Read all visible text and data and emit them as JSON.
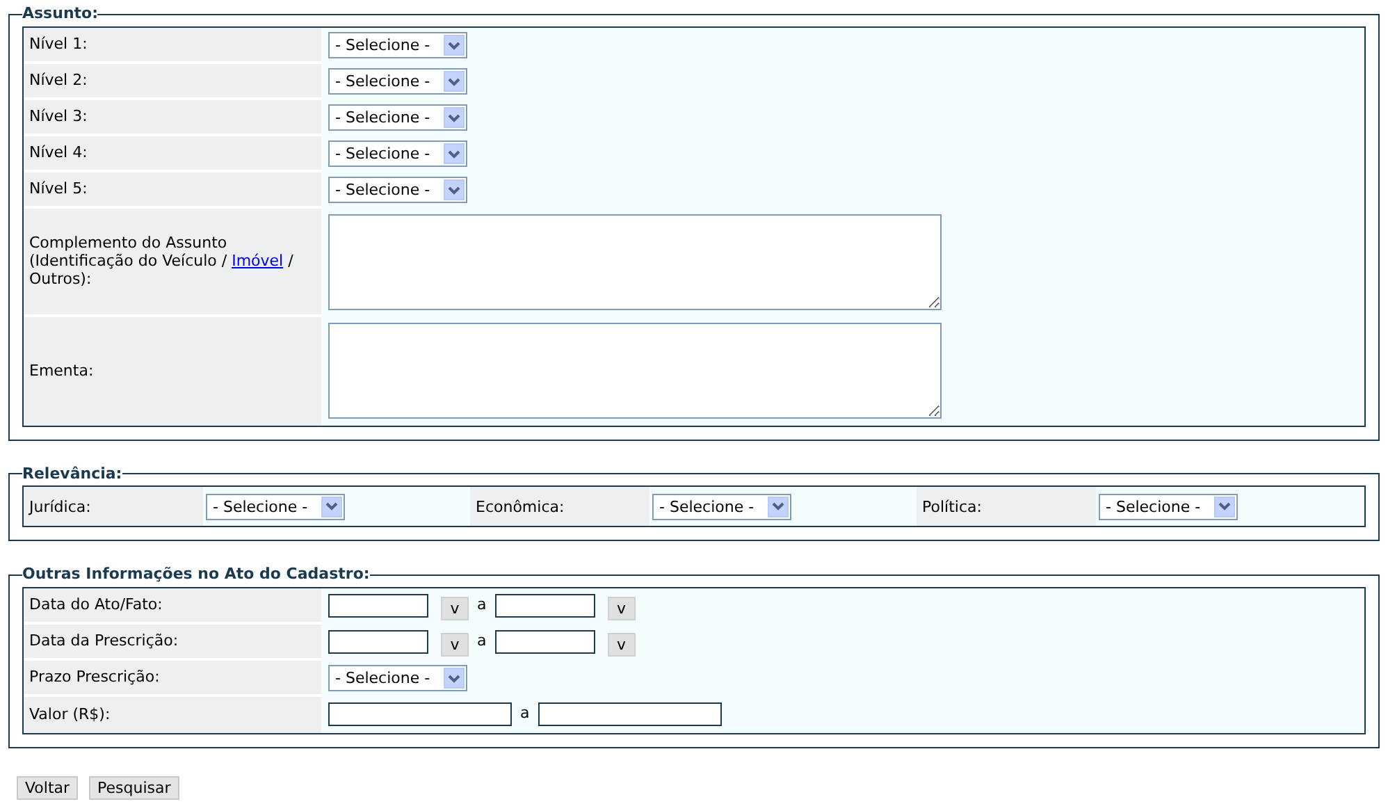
{
  "sections": [
    {
      "kind": "rows",
      "legend": "Assunto:",
      "rows": [
        {
          "kind": "select",
          "label": "Nível 1:",
          "value": "- Selecione -"
        },
        {
          "kind": "select",
          "label": "Nível 2:",
          "value": "- Selecione -"
        },
        {
          "kind": "select",
          "label": "Nível 3:",
          "value": "- Selecione -"
        },
        {
          "kind": "select",
          "label": "Nível 4:",
          "value": "- Selecione -"
        },
        {
          "kind": "select",
          "label": "Nível 5:",
          "value": "- Selecione -"
        },
        {
          "kind": "textarea",
          "label": "Complemento do Assunto (Identificação do Veículo /",
          "link": "Imóvel",
          "label_end": "/ Outros):"
        },
        {
          "kind": "textarea",
          "label": "Ementa:"
        }
      ]
    },
    {
      "kind": "columns",
      "legend": "Relevância:",
      "items": [
        {
          "label": "Jurídica:",
          "value": "- Selecione -"
        },
        {
          "label": "Econômica:",
          "value": "- Selecione -"
        },
        {
          "label": "Política:",
          "value": "- Selecione -"
        }
      ]
    },
    {
      "kind": "rows",
      "legend": "Outras Informações no Ato do Cadastro:",
      "rows": [
        {
          "kind": "date_range",
          "label": "Data do Ato/Fato:",
          "button": "v",
          "separator": "a",
          "button_end": "v"
        },
        {
          "kind": "date_range",
          "label": "Data da Prescrição:",
          "button": "v",
          "separator": "a",
          "button_end": "v"
        },
        {
          "kind": "select",
          "label": "Prazo Prescrição:",
          "value": "- Selecione -"
        },
        {
          "kind": "range",
          "label": "Valor (R$):",
          "separator": "a"
        }
      ]
    }
  ],
  "buttons": [
    "Voltar",
    "Pesquisar"
  ]
}
